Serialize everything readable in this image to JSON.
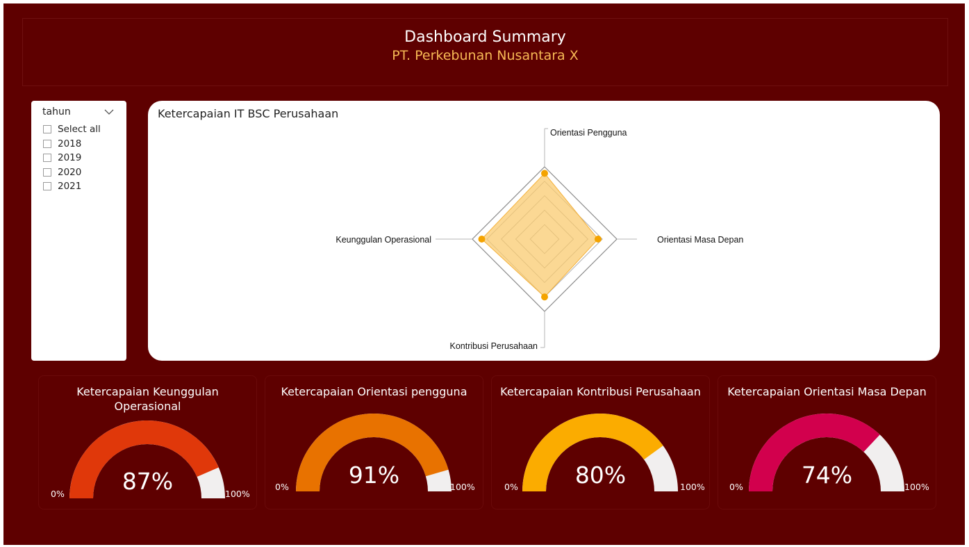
{
  "header": {
    "title": "Dashboard Summary",
    "subtitle": "PT. Perkebunan Nusantara X"
  },
  "slicer": {
    "title": "tahun",
    "items": [
      "Select all",
      "2018",
      "2019",
      "2020",
      "2021"
    ]
  },
  "radar": {
    "title": "Ketercapaian IT BSC Perusahaan",
    "axes": {
      "top": "Orientasi Pengguna",
      "right": "Orientasi Masa Depan",
      "bottom": "Kontribusi Perusahaan",
      "left": "Keunggulan Operasional"
    }
  },
  "gauges": [
    {
      "title_line1": "Ketercapaian Keunggulan",
      "title_line2": "Operasional",
      "value": "87%",
      "min": "0%",
      "max": "100%"
    },
    {
      "title_line1": "Ketercapaian Orientasi pengguna",
      "title_line2": "",
      "value": "91%",
      "min": "0%",
      "max": "100%"
    },
    {
      "title_line1": "Ketercapaian Kontribusi Perusahaan",
      "title_line2": "",
      "value": "80%",
      "min": "0%",
      "max": "100%"
    },
    {
      "title_line1": "Ketercapaian Orientasi Masa Depan",
      "title_line2": "",
      "value": "74%",
      "min": "0%",
      "max": "100%"
    }
  ],
  "colors": {
    "background": "#5e0000",
    "subtitle": "#f7b955",
    "radar_fill": "#f9c96b",
    "radar_point": "#f4a300",
    "gauge_track": "#f1efef",
    "gauge_1": "#e0380a",
    "gauge_2": "#e87200",
    "gauge_3": "#fbac00",
    "gauge_4": "#d2004d"
  },
  "chart_data": [
    {
      "type": "radar",
      "title": "Ketercapaian IT BSC Perusahaan",
      "categories": [
        "Orientasi Pengguna",
        "Orientasi Masa Depan",
        "Kontribusi Perusahaan",
        "Keunggulan Operasional"
      ],
      "values": [
        91,
        74,
        80,
        87
      ],
      "rmax": 100,
      "rings": 5
    },
    {
      "type": "gauge",
      "title": "Ketercapaian Keunggulan Operasional",
      "value": 87,
      "min": 0,
      "max": 100
    },
    {
      "type": "gauge",
      "title": "Ketercapaian Orientasi pengguna",
      "value": 91,
      "min": 0,
      "max": 100
    },
    {
      "type": "gauge",
      "title": "Ketercapaian Kontribusi Perusahaan",
      "value": 80,
      "min": 0,
      "max": 100
    },
    {
      "type": "gauge",
      "title": "Ketercapaian Orientasi Masa Depan",
      "value": 74,
      "min": 0,
      "max": 100
    }
  ]
}
